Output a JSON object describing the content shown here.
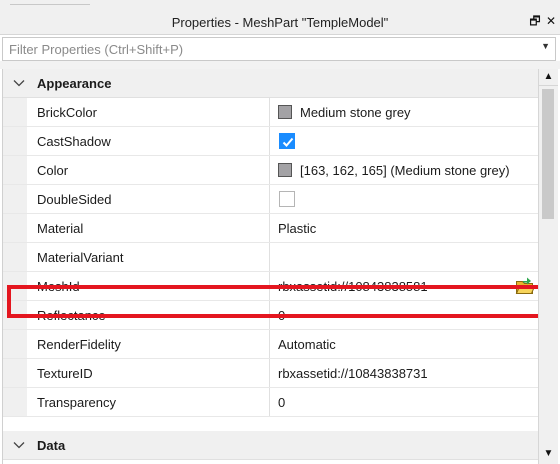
{
  "window": {
    "title": "Properties - MeshPart \"TempleModel\"",
    "dock_glyph": "🗗",
    "close_glyph": "✕"
  },
  "filter": {
    "placeholder": "Filter Properties (Ctrl+Shift+P)",
    "dropdown_glyph": "▼"
  },
  "categories": {
    "appearance": "Appearance",
    "data": "Data"
  },
  "props": {
    "brickcolor": {
      "name": "BrickColor",
      "value": "Medium stone grey",
      "swatch_color": "#a3a2a5"
    },
    "castshadow": {
      "name": "CastShadow",
      "checked": true
    },
    "color": {
      "name": "Color",
      "value": "[163, 162, 165] (Medium stone grey)",
      "swatch_color": "#a3a2a5"
    },
    "doublesided": {
      "name": "DoubleSided",
      "checked": false
    },
    "material": {
      "name": "Material",
      "value": "Plastic"
    },
    "materialvariant": {
      "name": "MaterialVariant",
      "value": ""
    },
    "meshid": {
      "name": "MeshId",
      "value": "rbxassetid://10843838581"
    },
    "reflectance": {
      "name": "Reflectance",
      "value": "0"
    },
    "renderfidelity": {
      "name": "RenderFidelity",
      "value": "Automatic"
    },
    "textureid": {
      "name": "TextureID",
      "value": "rbxassetid://10843838731"
    },
    "transparency": {
      "name": "Transparency",
      "value": "0"
    }
  },
  "scrollbar": {
    "up_glyph": "▲",
    "down_glyph": "▼"
  },
  "colors": {
    "highlight": "#e4161f",
    "checkbox_on": "#1a8cff",
    "icons": [
      "chevron-down-icon",
      "folder-open-icon",
      "checkmark-icon",
      "restore-window-icon",
      "close-icon"
    ]
  }
}
